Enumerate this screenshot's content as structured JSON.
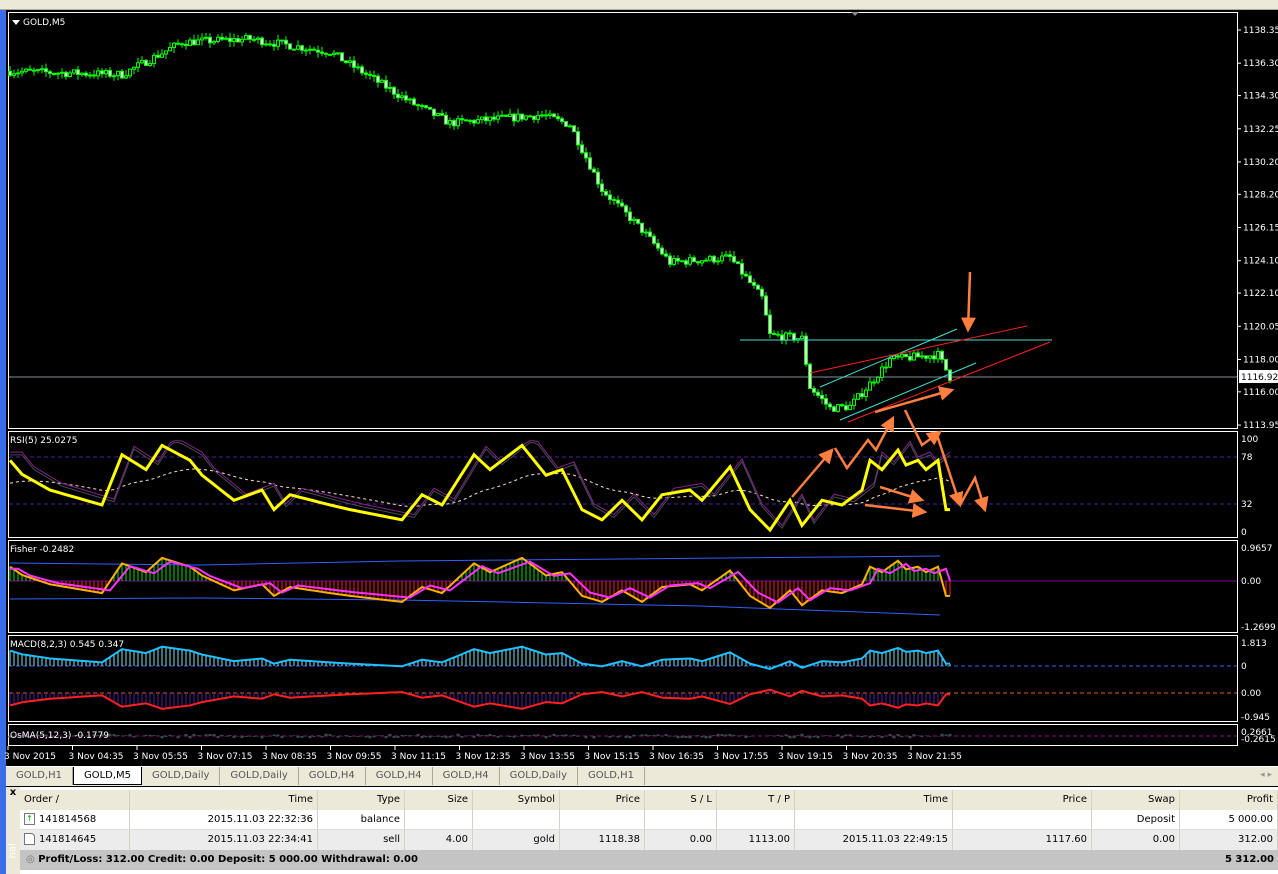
{
  "chart": {
    "title": "GOLD,M5",
    "current_price": "1116.92",
    "price_axis": [
      "1138.35",
      "1136.30",
      "1134.30",
      "1132.25",
      "1130.20",
      "1128.20",
      "1126.15",
      "1124.10",
      "1122.10",
      "1120.05",
      "1118.00",
      "1116.00",
      "1113.95"
    ],
    "time_axis": [
      "3 Nov 2015",
      "3 Nov 04:35",
      "3 Nov 05:55",
      "3 Nov 07:15",
      "3 Nov 08:35",
      "3 Nov 09:55",
      "3 Nov 11:15",
      "3 Nov 12:35",
      "3 Nov 13:55",
      "3 Nov 15:15",
      "3 Nov 16:35",
      "3 Nov 17:55",
      "3 Nov 19:15",
      "3 Nov 20:35",
      "3 Nov 21:55"
    ],
    "rsi": {
      "label": "RSI(5) 25.0275",
      "axis": [
        "100",
        "78",
        "32",
        "0"
      ]
    },
    "fisher": {
      "label": "Fisher -0.2482",
      "axis": [
        "0.9657",
        "0.00",
        "-1.2699"
      ]
    },
    "macd": {
      "label": "MACD(8,2,3) 0.545 0.347",
      "axis": [
        "1.813",
        "0",
        "0.00",
        "-0.945"
      ]
    },
    "osma": {
      "label": "OsMA(5,12,3) -0.1779",
      "axis": [
        "0.2661",
        "-0.2615"
      ]
    },
    "colors": {
      "candle": "#00ff00",
      "rsi": "#ffff00",
      "arrow": "#ff7f3f",
      "cyan": "#40e0d0",
      "red": "#ff2020"
    }
  },
  "chart_data": {
    "type": "line",
    "title": "GOLD,M5",
    "price_anchors": [
      [
        0,
        1135.8
      ],
      [
        28,
        1135.6
      ],
      [
        43,
        1137.6
      ],
      [
        60,
        1137.8
      ],
      [
        80,
        1137.0
      ],
      [
        93,
        1135.0
      ],
      [
        100,
        1133.9
      ],
      [
        110,
        1132.6
      ],
      [
        133,
        1133.1
      ],
      [
        140,
        1132.5
      ],
      [
        148,
        1128.5
      ],
      [
        158,
        1126.0
      ],
      [
        165,
        1124.0
      ],
      [
        180,
        1124.3
      ],
      [
        188,
        1121.8
      ],
      [
        190,
        1119.5
      ],
      [
        198,
        1119.3
      ],
      [
        200,
        1116.3
      ],
      [
        205,
        1115.0
      ],
      [
        210,
        1115.1
      ],
      [
        215,
        1116.5
      ],
      [
        220,
        1118.0
      ],
      [
        232,
        1118.3
      ],
      [
        235,
        1116.9
      ]
    ],
    "rsi_anchors": [
      [
        0,
        76
      ],
      [
        3,
        61
      ],
      [
        10,
        44
      ],
      [
        23,
        28
      ],
      [
        28,
        82
      ],
      [
        34,
        66
      ],
      [
        38,
        92
      ],
      [
        45,
        76
      ],
      [
        48,
        60
      ],
      [
        56,
        33
      ],
      [
        63,
        44
      ],
      [
        66,
        23
      ],
      [
        70,
        39
      ],
      [
        80,
        28
      ],
      [
        85,
        23
      ],
      [
        98,
        12
      ],
      [
        103,
        39
      ],
      [
        108,
        28
      ],
      [
        116,
        82
      ],
      [
        120,
        66
      ],
      [
        128,
        92
      ],
      [
        134,
        60
      ],
      [
        138,
        66
      ],
      [
        143,
        23
      ],
      [
        148,
        12
      ],
      [
        153,
        33
      ],
      [
        158,
        12
      ],
      [
        163,
        39
      ],
      [
        170,
        44
      ],
      [
        173,
        33
      ],
      [
        180,
        69
      ],
      [
        185,
        23
      ],
      [
        190,
        1
      ],
      [
        195,
        33
      ],
      [
        198,
        6
      ],
      [
        203,
        33
      ],
      [
        208,
        28
      ],
      [
        213,
        44
      ],
      [
        215,
        76
      ],
      [
        218,
        66
      ],
      [
        222,
        87
      ],
      [
        224,
        71
      ],
      [
        227,
        76
      ],
      [
        229,
        66
      ],
      [
        232,
        76
      ],
      [
        234,
        23
      ]
    ],
    "ylim": [
      1113.95,
      1138.35
    ]
  },
  "tabs": [
    "GOLD,H1",
    "GOLD,M5",
    "GOLD,Daily",
    "GOLD,Daily",
    "GOLD,H4",
    "GOLD,H4",
    "GOLD,H4",
    "GOLD,Daily",
    "GOLD,H1"
  ],
  "terminal": {
    "close": "x",
    "side_label": "nal",
    "headers": [
      "Order  /",
      "Time",
      "Type",
      "Size",
      "Symbol",
      "Price",
      "S / L",
      "T / P",
      "Time",
      "Price",
      "Swap",
      "Profit"
    ],
    "rows": [
      [
        "141814568",
        "2015.11.03 22:32:36",
        "balance",
        "",
        "",
        "",
        "",
        "",
        "",
        "",
        "Deposit",
        "5 000.00"
      ],
      [
        "141814645",
        "2015.11.03 22:34:41",
        "sell",
        "4.00",
        "gold",
        "1118.38",
        "0.00",
        "1113.00",
        "2015.11.03 22:49:15",
        "1117.60",
        "0.00",
        "312.00"
      ]
    ],
    "summary": "Profit/Loss: 312.00  Credit: 0.00  Deposit: 5 000.00  Withdrawal: 0.00",
    "total": "5 312.00"
  }
}
